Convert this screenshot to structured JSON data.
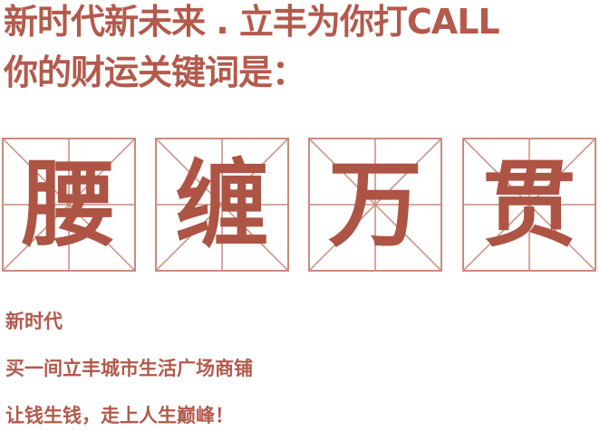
{
  "headline": {
    "line1": "新时代新未来 . 立丰为你打CALL",
    "line2": "你的财运关键词是："
  },
  "keyword": {
    "chars": [
      "腰",
      "缠",
      "万",
      "贯"
    ]
  },
  "body": {
    "line1": "新时代",
    "line2": "买一间立丰城市生活广场商铺",
    "line3": "让钱生钱，走上人生巅峰！"
  },
  "colors": {
    "text": "#b35a4c",
    "grid_line": "#c98b7f",
    "keyword_text": "#ad5444"
  }
}
